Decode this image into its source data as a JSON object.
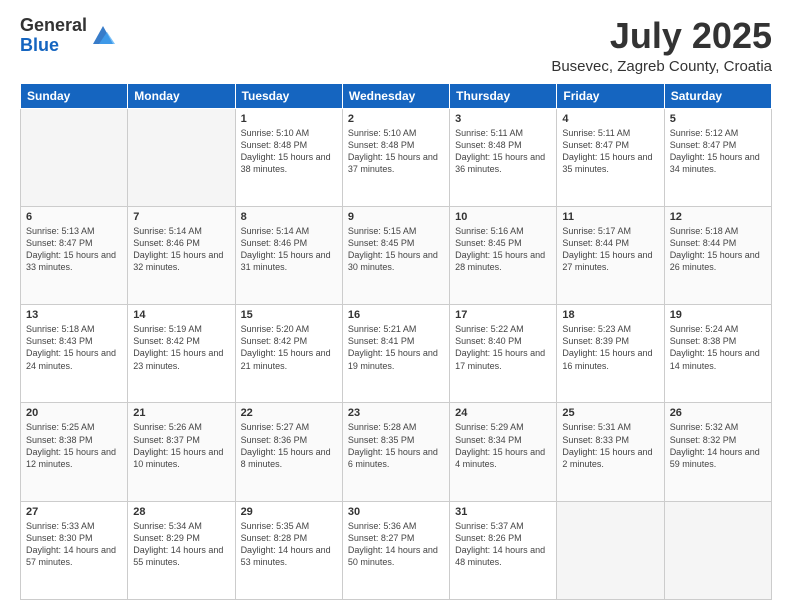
{
  "logo": {
    "general": "General",
    "blue": "Blue"
  },
  "header": {
    "month": "July 2025",
    "location": "Busevec, Zagreb County, Croatia"
  },
  "weekdays": [
    "Sunday",
    "Monday",
    "Tuesday",
    "Wednesday",
    "Thursday",
    "Friday",
    "Saturday"
  ],
  "weeks": [
    [
      {
        "day": "",
        "sunrise": "",
        "sunset": "",
        "daylight": ""
      },
      {
        "day": "",
        "sunrise": "",
        "sunset": "",
        "daylight": ""
      },
      {
        "day": "1",
        "sunrise": "Sunrise: 5:10 AM",
        "sunset": "Sunset: 8:48 PM",
        "daylight": "Daylight: 15 hours and 38 minutes."
      },
      {
        "day": "2",
        "sunrise": "Sunrise: 5:10 AM",
        "sunset": "Sunset: 8:48 PM",
        "daylight": "Daylight: 15 hours and 37 minutes."
      },
      {
        "day": "3",
        "sunrise": "Sunrise: 5:11 AM",
        "sunset": "Sunset: 8:48 PM",
        "daylight": "Daylight: 15 hours and 36 minutes."
      },
      {
        "day": "4",
        "sunrise": "Sunrise: 5:11 AM",
        "sunset": "Sunset: 8:47 PM",
        "daylight": "Daylight: 15 hours and 35 minutes."
      },
      {
        "day": "5",
        "sunrise": "Sunrise: 5:12 AM",
        "sunset": "Sunset: 8:47 PM",
        "daylight": "Daylight: 15 hours and 34 minutes."
      }
    ],
    [
      {
        "day": "6",
        "sunrise": "Sunrise: 5:13 AM",
        "sunset": "Sunset: 8:47 PM",
        "daylight": "Daylight: 15 hours and 33 minutes."
      },
      {
        "day": "7",
        "sunrise": "Sunrise: 5:14 AM",
        "sunset": "Sunset: 8:46 PM",
        "daylight": "Daylight: 15 hours and 32 minutes."
      },
      {
        "day": "8",
        "sunrise": "Sunrise: 5:14 AM",
        "sunset": "Sunset: 8:46 PM",
        "daylight": "Daylight: 15 hours and 31 minutes."
      },
      {
        "day": "9",
        "sunrise": "Sunrise: 5:15 AM",
        "sunset": "Sunset: 8:45 PM",
        "daylight": "Daylight: 15 hours and 30 minutes."
      },
      {
        "day": "10",
        "sunrise": "Sunrise: 5:16 AM",
        "sunset": "Sunset: 8:45 PM",
        "daylight": "Daylight: 15 hours and 28 minutes."
      },
      {
        "day": "11",
        "sunrise": "Sunrise: 5:17 AM",
        "sunset": "Sunset: 8:44 PM",
        "daylight": "Daylight: 15 hours and 27 minutes."
      },
      {
        "day": "12",
        "sunrise": "Sunrise: 5:18 AM",
        "sunset": "Sunset: 8:44 PM",
        "daylight": "Daylight: 15 hours and 26 minutes."
      }
    ],
    [
      {
        "day": "13",
        "sunrise": "Sunrise: 5:18 AM",
        "sunset": "Sunset: 8:43 PM",
        "daylight": "Daylight: 15 hours and 24 minutes."
      },
      {
        "day": "14",
        "sunrise": "Sunrise: 5:19 AM",
        "sunset": "Sunset: 8:42 PM",
        "daylight": "Daylight: 15 hours and 23 minutes."
      },
      {
        "day": "15",
        "sunrise": "Sunrise: 5:20 AM",
        "sunset": "Sunset: 8:42 PM",
        "daylight": "Daylight: 15 hours and 21 minutes."
      },
      {
        "day": "16",
        "sunrise": "Sunrise: 5:21 AM",
        "sunset": "Sunset: 8:41 PM",
        "daylight": "Daylight: 15 hours and 19 minutes."
      },
      {
        "day": "17",
        "sunrise": "Sunrise: 5:22 AM",
        "sunset": "Sunset: 8:40 PM",
        "daylight": "Daylight: 15 hours and 17 minutes."
      },
      {
        "day": "18",
        "sunrise": "Sunrise: 5:23 AM",
        "sunset": "Sunset: 8:39 PM",
        "daylight": "Daylight: 15 hours and 16 minutes."
      },
      {
        "day": "19",
        "sunrise": "Sunrise: 5:24 AM",
        "sunset": "Sunset: 8:38 PM",
        "daylight": "Daylight: 15 hours and 14 minutes."
      }
    ],
    [
      {
        "day": "20",
        "sunrise": "Sunrise: 5:25 AM",
        "sunset": "Sunset: 8:38 PM",
        "daylight": "Daylight: 15 hours and 12 minutes."
      },
      {
        "day": "21",
        "sunrise": "Sunrise: 5:26 AM",
        "sunset": "Sunset: 8:37 PM",
        "daylight": "Daylight: 15 hours and 10 minutes."
      },
      {
        "day": "22",
        "sunrise": "Sunrise: 5:27 AM",
        "sunset": "Sunset: 8:36 PM",
        "daylight": "Daylight: 15 hours and 8 minutes."
      },
      {
        "day": "23",
        "sunrise": "Sunrise: 5:28 AM",
        "sunset": "Sunset: 8:35 PM",
        "daylight": "Daylight: 15 hours and 6 minutes."
      },
      {
        "day": "24",
        "sunrise": "Sunrise: 5:29 AM",
        "sunset": "Sunset: 8:34 PM",
        "daylight": "Daylight: 15 hours and 4 minutes."
      },
      {
        "day": "25",
        "sunrise": "Sunrise: 5:31 AM",
        "sunset": "Sunset: 8:33 PM",
        "daylight": "Daylight: 15 hours and 2 minutes."
      },
      {
        "day": "26",
        "sunrise": "Sunrise: 5:32 AM",
        "sunset": "Sunset: 8:32 PM",
        "daylight": "Daylight: 14 hours and 59 minutes."
      }
    ],
    [
      {
        "day": "27",
        "sunrise": "Sunrise: 5:33 AM",
        "sunset": "Sunset: 8:30 PM",
        "daylight": "Daylight: 14 hours and 57 minutes."
      },
      {
        "day": "28",
        "sunrise": "Sunrise: 5:34 AM",
        "sunset": "Sunset: 8:29 PM",
        "daylight": "Daylight: 14 hours and 55 minutes."
      },
      {
        "day": "29",
        "sunrise": "Sunrise: 5:35 AM",
        "sunset": "Sunset: 8:28 PM",
        "daylight": "Daylight: 14 hours and 53 minutes."
      },
      {
        "day": "30",
        "sunrise": "Sunrise: 5:36 AM",
        "sunset": "Sunset: 8:27 PM",
        "daylight": "Daylight: 14 hours and 50 minutes."
      },
      {
        "day": "31",
        "sunrise": "Sunrise: 5:37 AM",
        "sunset": "Sunset: 8:26 PM",
        "daylight": "Daylight: 14 hours and 48 minutes."
      },
      {
        "day": "",
        "sunrise": "",
        "sunset": "",
        "daylight": ""
      },
      {
        "day": "",
        "sunrise": "",
        "sunset": "",
        "daylight": ""
      }
    ]
  ]
}
